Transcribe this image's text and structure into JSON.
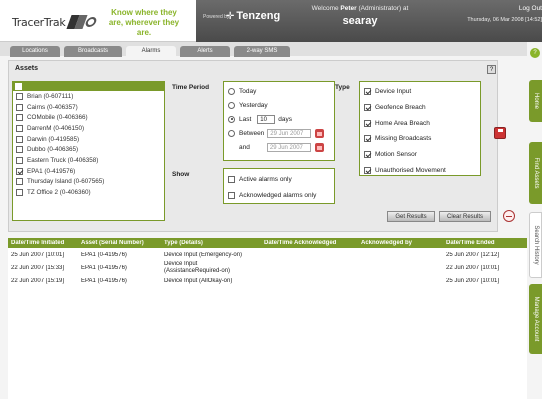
{
  "header": {
    "logo_text": "TracerTrak",
    "slogan": "Know where they are, wherever they are.",
    "powered_by": "Powered by",
    "brand": "Tenzeng",
    "welcome_prefix": "Welcome",
    "user_name": "Peter",
    "user_role": "(Administrator) at",
    "company": "searay",
    "logout": "Log Out",
    "datetime": "Thursday, 06 Mar 2008 [14:52]"
  },
  "tabs": [
    {
      "label": "Locations",
      "active": false
    },
    {
      "label": "Broadcasts",
      "active": false
    },
    {
      "label": "Alarms",
      "active": true
    },
    {
      "label": "Alerts",
      "active": false
    },
    {
      "label": "2-way SMS",
      "active": false
    }
  ],
  "assets": {
    "title": "Assets",
    "help_icon": "?",
    "items": [
      {
        "label": "Brian (0-607111)",
        "checked": false
      },
      {
        "label": "Cairns (0-406357)",
        "checked": false
      },
      {
        "label": "COMobile (0-406366)",
        "checked": false
      },
      {
        "label": "DarrenM (0-406150)",
        "checked": false
      },
      {
        "label": "Darwin (0-419585)",
        "checked": false
      },
      {
        "label": "Dubbo (0-406365)",
        "checked": false
      },
      {
        "label": "Eastern Truck (0-406358)",
        "checked": false
      },
      {
        "label": "EPA1 (0-419576)",
        "checked": true
      },
      {
        "label": "Thursday Island (0-607565)",
        "checked": false
      },
      {
        "label": "TZ Office 2 (0-406360)",
        "checked": false
      }
    ]
  },
  "time_period": {
    "label": "Time Period",
    "today": "Today",
    "yesterday": "Yesterday",
    "last": "Last",
    "last_value": "10",
    "days": "days",
    "between": "Between",
    "and": "and",
    "date_from": "29 Jun 2007",
    "date_to": "29 Jun 2007",
    "selected": "last"
  },
  "show": {
    "label": "Show",
    "active_only": "Active alarms only",
    "acknowledged_only": "Acknowledged alarms only"
  },
  "type": {
    "label": "Type",
    "items": [
      {
        "label": "Device Input",
        "checked": true
      },
      {
        "label": "Geofence Breach",
        "checked": true
      },
      {
        "label": "Home Area Breach",
        "checked": true
      },
      {
        "label": "Missing Broadcasts",
        "checked": true
      },
      {
        "label": "Motion Sensor",
        "checked": true
      },
      {
        "label": "Unauthorised Movement",
        "checked": true
      }
    ]
  },
  "buttons": {
    "get_results": "Get Results",
    "clear_results": "Clear Results"
  },
  "results": {
    "columns": [
      "Date/Time Initiated",
      "Asset (Serial Number)",
      "Type (Details)",
      "Date/Time Acknowledged",
      "Acknowledged by",
      "Date/Time Ended"
    ],
    "rows": [
      {
        "initiated": "25 Jun 2007 [10:01]",
        "asset": "EPA1 (0-419576)",
        "type": "Device Input (Emergency-on)",
        "type2": "",
        "acknowledged": "",
        "ack_by": "",
        "ended": "25 Jun 2007 [12:12]"
      },
      {
        "initiated": "22 Jun 2007 [15:33]",
        "asset": "EPA1 (0-419576)",
        "type": "Device Input",
        "type2": "(AssistanceRequired-on)",
        "acknowledged": "",
        "ack_by": "",
        "ended": "22 Jun 2007 [10:01]"
      },
      {
        "initiated": "22 Jun 2007 [15:19]",
        "asset": "EPA1 (0-419576)",
        "type": "Device Input (AllOkay-on)",
        "type2": "",
        "acknowledged": "",
        "ack_by": "",
        "ended": "25 Jun 2007 [10:01]"
      }
    ]
  },
  "side_tabs": [
    "Home",
    "Find Assets",
    "Search History",
    "Manage Account"
  ],
  "side_help": "?",
  "colors": {
    "accent": "#7a9a2a",
    "slogan": "#8ab42a",
    "header_bar": "#555555"
  }
}
